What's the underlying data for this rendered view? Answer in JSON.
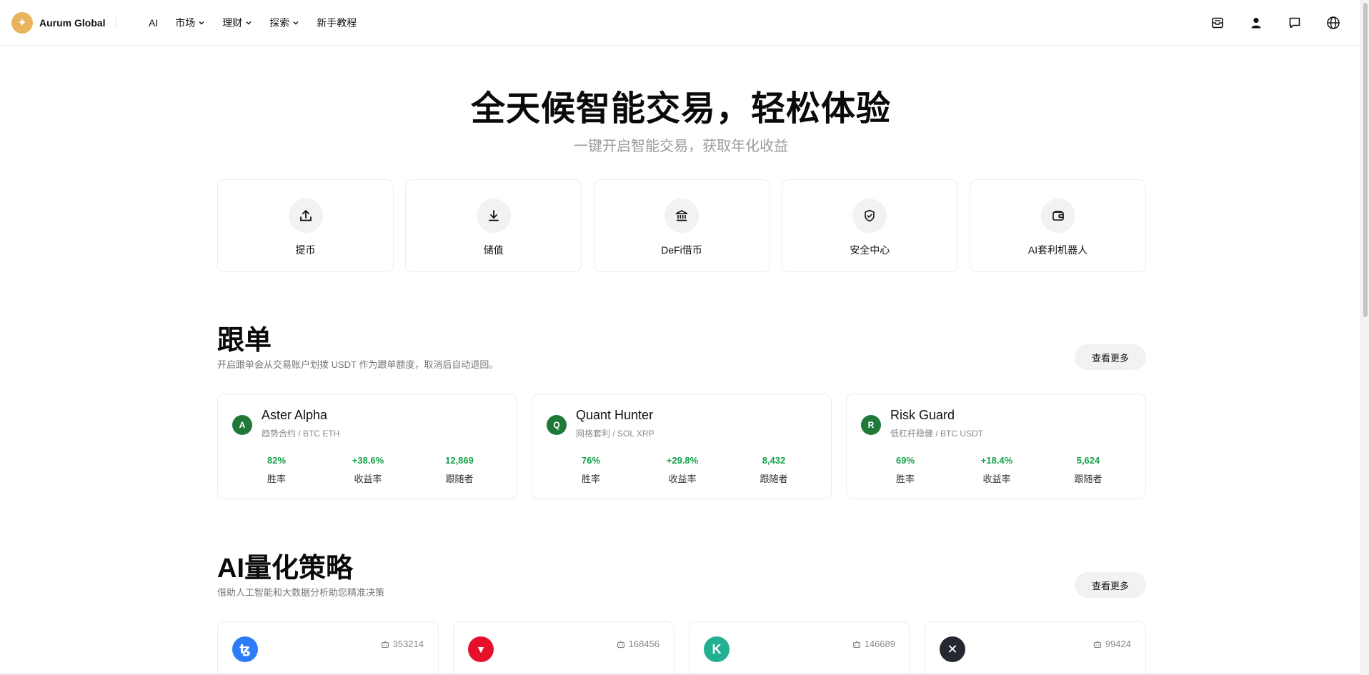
{
  "brand": {
    "name": "Aurum Global",
    "logo_icon": "sparkle-icon",
    "logo_color": "#e8b45d"
  },
  "nav": {
    "items": [
      {
        "label": "AI",
        "has_dropdown": false
      },
      {
        "label": "市场",
        "has_dropdown": true
      },
      {
        "label": "理财",
        "has_dropdown": true
      },
      {
        "label": "探索",
        "has_dropdown": true
      },
      {
        "label": "新手教程",
        "has_dropdown": false
      }
    ]
  },
  "header_icons": [
    "mailbox-icon",
    "user-icon",
    "chat-icon",
    "globe-icon"
  ],
  "hero": {
    "title": "全天候智能交易，轻松体验",
    "subtitle": "一键开启智能交易，获取年化收益"
  },
  "actions": [
    {
      "label": "提币",
      "icon": "upload-icon"
    },
    {
      "label": "储值",
      "icon": "download-icon"
    },
    {
      "label": "DeFi借币",
      "icon": "bank-icon"
    },
    {
      "label": "安全中心",
      "icon": "shield-check-icon"
    },
    {
      "label": "AI套利机器人",
      "icon": "wallet-icon"
    }
  ],
  "copy_trading": {
    "title": "跟单",
    "desc": "开启跟单会从交易账户划拨 USDT 作为跟单额度，取消后自动退回。",
    "more_label": "查看更多",
    "stat_labels": [
      "胜率",
      "收益率",
      "跟随者"
    ],
    "traders": [
      {
        "initial": "A",
        "name": "Aster Alpha",
        "sub": "趋势合约 / BTC ETH",
        "win_rate": "82%",
        "return": "+38.6%",
        "followers": "12,869"
      },
      {
        "initial": "Q",
        "name": "Quant Hunter",
        "sub": "网格套利 / SOL XRP",
        "win_rate": "76%",
        "return": "+29.8%",
        "followers": "8,432"
      },
      {
        "initial": "R",
        "name": "Risk Guard",
        "sub": "低杠杆稳健 / BTC USDT",
        "win_rate": "69%",
        "return": "+18.4%",
        "followers": "5,624"
      }
    ],
    "accent_color": "#16a34a",
    "avatar_color": "#1f7a3a"
  },
  "ai_strategy": {
    "title": "AI量化策略",
    "desc": "借助人工智能和大数据分析助您精准决策",
    "more_label": "查看更多",
    "cards": [
      {
        "coin_icon": "tezos-icon",
        "coin_color": "#2c7df7",
        "glyph": "ꜩ",
        "count": "353214"
      },
      {
        "coin_icon": "tron-icon",
        "coin_color": "#e5112b",
        "glyph": "▼",
        "count": "168456"
      },
      {
        "coin_icon": "kucoin-icon",
        "coin_color": "#23af91",
        "glyph": "K",
        "count": "146689"
      },
      {
        "coin_icon": "xrp-icon",
        "coin_color": "#23292f",
        "glyph": "✕",
        "count": "99424"
      }
    ]
  }
}
